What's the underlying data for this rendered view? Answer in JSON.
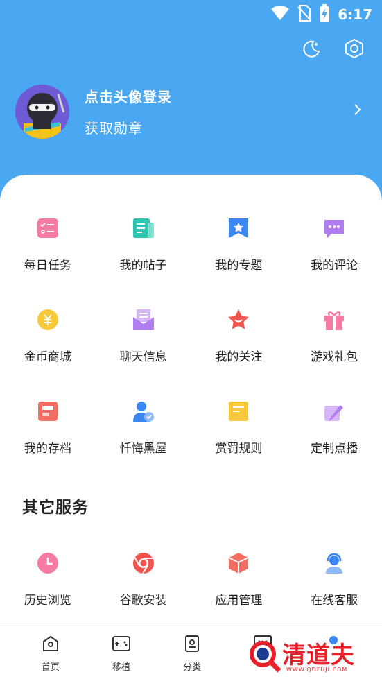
{
  "status": {
    "time": "6:17"
  },
  "profile": {
    "login": "点击头像登录",
    "badge": "获取勋章"
  },
  "grid": [
    [
      "每日任务",
      "我的帖子",
      "我的专题",
      "我的评论"
    ],
    [
      "金币商城",
      "聊天信息",
      "我的关注",
      "游戏礼包"
    ],
    [
      "我的存档",
      "忏悔黑屋",
      "赏罚规则",
      "定制点播"
    ]
  ],
  "other_services": {
    "title": "其它服务",
    "items": [
      "历史浏览",
      "谷歌安装",
      "应用管理",
      "在线客服"
    ]
  },
  "nav": [
    "首页",
    "移植",
    "分类"
  ],
  "watermark": {
    "text": "清道夫",
    "url": "WWW.QDFUJI.COM"
  },
  "colors": {
    "header": "#4aa8f3",
    "accent_red": "#f2554e",
    "accent_pink": "#f57aa4",
    "accent_teal": "#2ec5b0",
    "accent_blue": "#3b86f0",
    "accent_purple": "#b07ef0",
    "accent_yellow": "#f7c93a"
  }
}
